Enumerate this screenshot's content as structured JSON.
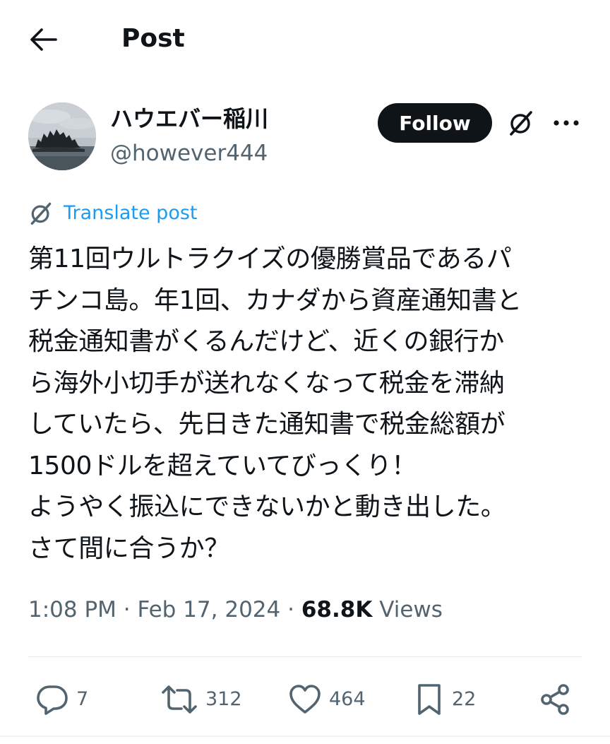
{
  "header": {
    "title": "Post",
    "back_icon": "arrow-left-icon"
  },
  "author": {
    "display_name": "ハウエバー稲川",
    "handle": "@however444",
    "avatar": "island-landscape-avatar"
  },
  "actions_top": {
    "follow_label": "Follow",
    "grok_icon": "grok-icon",
    "more_icon": "more-horizontal-icon"
  },
  "translate": {
    "label": "Translate post",
    "icon": "grok-icon"
  },
  "post": {
    "lines": [
      "第11回ウルトラクイズの優勝賞品であるパ",
      "チンコ島。年1回、カナダから資産通知書と",
      "税金通知書がくるんだけど、近くの銀行か",
      "ら海外小切手が送れなくなって税金を滞納",
      "していたら、先日きた通知書で税金総額が",
      "1500ドルを超えていてびっくり！",
      "ようやく振込にできないかと動き出した。",
      "さて間に合うか？"
    ]
  },
  "meta": {
    "timestamp": "1:08 PM · Feb 17, 2024 · ",
    "views_count": "68.8K",
    "views_label": " Views"
  },
  "engagement": {
    "replies": "7",
    "reposts": "312",
    "likes": "464",
    "bookmarks": "22",
    "icons": [
      "reply-icon",
      "repost-icon",
      "like-icon",
      "bookmark-icon",
      "share-icon"
    ]
  },
  "colors": {
    "text_primary": "#0f1419",
    "text_secondary": "#536471",
    "accent": "#1d9bf0",
    "follow_bg": "#0f1419"
  }
}
